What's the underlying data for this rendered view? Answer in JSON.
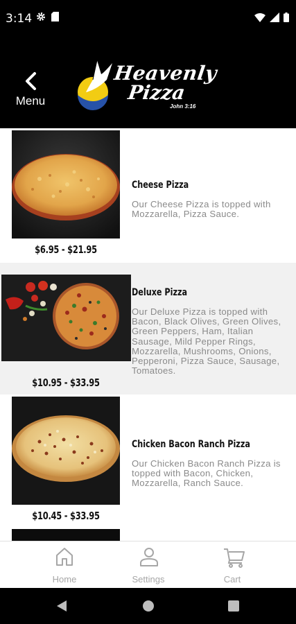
{
  "status_bar": {
    "time": "3:14",
    "icons": [
      "gear-icon",
      "sim-card-icon",
      "wifi-icon",
      "signal-icon",
      "battery-icon"
    ]
  },
  "header": {
    "menu_label": "Menu",
    "logo": {
      "line1": "Heavenly",
      "line2": "Pizza",
      "verse": "John 3:16"
    }
  },
  "menu_items": [
    {
      "name": "Cheese Pizza",
      "price": "$6.95 - $21.95",
      "description": "Our Cheese Pizza is topped with Mozzarella, Pizza Sauce."
    },
    {
      "name": "Deluxe Pizza",
      "price": "$10.95 - $33.95",
      "description": "Our Deluxe Pizza is topped with Bacon, Black Olives, Green Olives, Green Peppers, Ham, Italian Sausage, Mild Pepper Rings, Mozzarella, Mushrooms, Onions, Pepperoni, Pizza Sauce, Sausage, Tomatoes."
    },
    {
      "name": "Chicken Bacon Ranch Pizza",
      "price": "$10.45 - $33.95",
      "description": "Our Chicken Bacon Ranch Pizza is topped with Bacon, Chicken, Mozzarella, Ranch Sauce."
    }
  ],
  "bottom_nav": [
    {
      "label": "Home",
      "icon": "home-icon"
    },
    {
      "label": "Settings",
      "icon": "person-icon"
    },
    {
      "label": "Cart",
      "icon": "cart-icon"
    }
  ],
  "colors": {
    "header_bg": "#000000",
    "alt_row_bg": "#f1f1f1",
    "desc_text": "#8a8a8a",
    "nav_inactive": "#a6a6a6"
  }
}
